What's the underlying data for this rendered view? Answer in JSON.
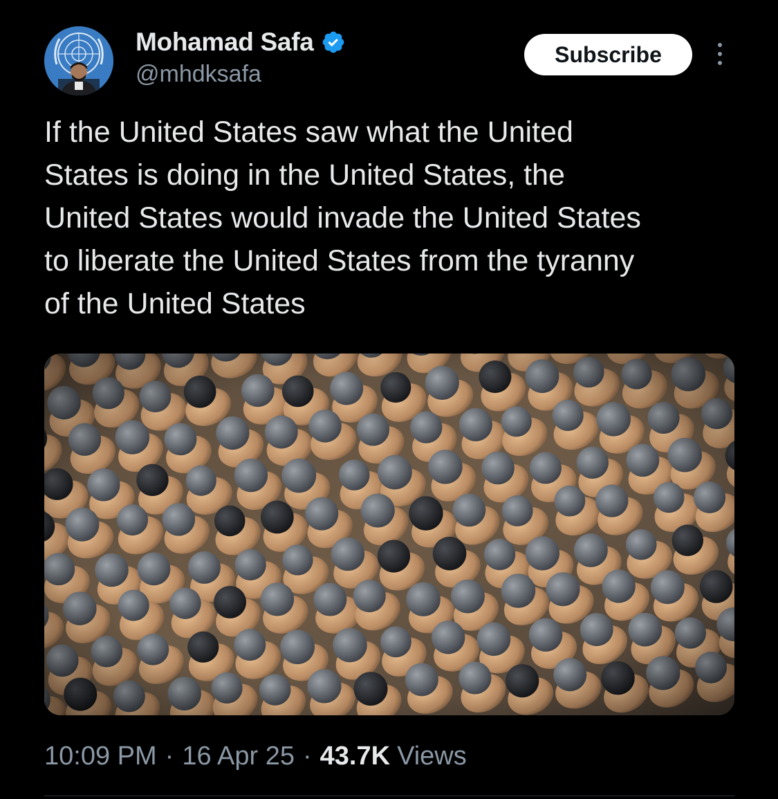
{
  "author": {
    "display_name": "Mohamad Safa",
    "handle": "@mhdksafa",
    "verified": true,
    "avatar_icon": "un-emblem-avatar"
  },
  "actions": {
    "subscribe_label": "Subscribe",
    "more_icon": "more-vertical-icon"
  },
  "tweet": {
    "text": "If the United States saw what the United\nStates is doing in the United States, the\nUnited States would invade the United States\nto liberate the United States from the tyranny\nof the United States"
  },
  "meta": {
    "time": "10:09 PM",
    "date": "16 Apr 25",
    "views_count": "43.7K",
    "views_label": "Views",
    "separator": "·"
  },
  "colors": {
    "background": "#000000",
    "primary_text": "#e7e9ea",
    "secondary_text": "#8b98a5",
    "verified_blue": "#1d9bf0",
    "button_bg": "#ffffff"
  }
}
